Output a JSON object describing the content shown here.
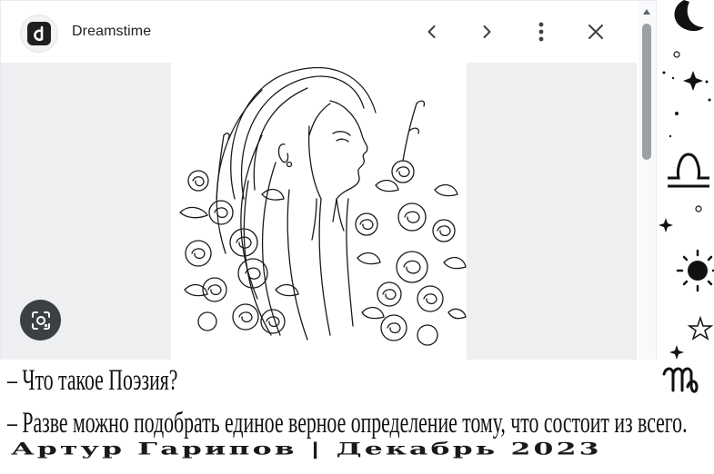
{
  "preview": {
    "site_name": "Dreamstime",
    "icons": {
      "site_logo": "dreamstime-logo-icon",
      "prev": "chevron-left-icon",
      "next": "chevron-right-icon",
      "more": "more-vert-icon",
      "close": "close-icon",
      "lens": "google-lens-icon"
    }
  },
  "poem": {
    "line1": "– Что такое Поэзия?",
    "line2": "– Разве можно подобрать единое верное определение тому, что состоит из всего."
  },
  "signature": "Артур Гарипов | Декабрь 2023",
  "colors": {
    "panel_bg": "#eeeff1",
    "lens_bg": "#3c3f43",
    "text": "#111111"
  }
}
